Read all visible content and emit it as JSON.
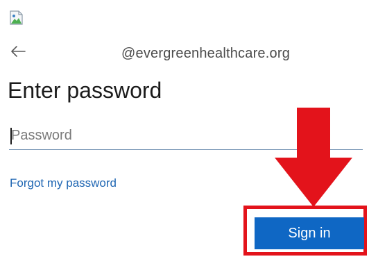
{
  "header": {
    "account_email": "@evergreenhealthcare.org"
  },
  "main": {
    "title": "Enter password",
    "password": {
      "placeholder": "Password",
      "value": ""
    },
    "forgot_password_label": "Forgot my password",
    "signin_label": "Sign in"
  },
  "icons": {
    "logo": "broken-image-icon",
    "back": "back-arrow-icon",
    "annotation_arrow": "red-down-arrow-icon"
  },
  "colors": {
    "primary_button": "#0f67c4",
    "link": "#1f66b3",
    "annotation": "#e3131b"
  }
}
